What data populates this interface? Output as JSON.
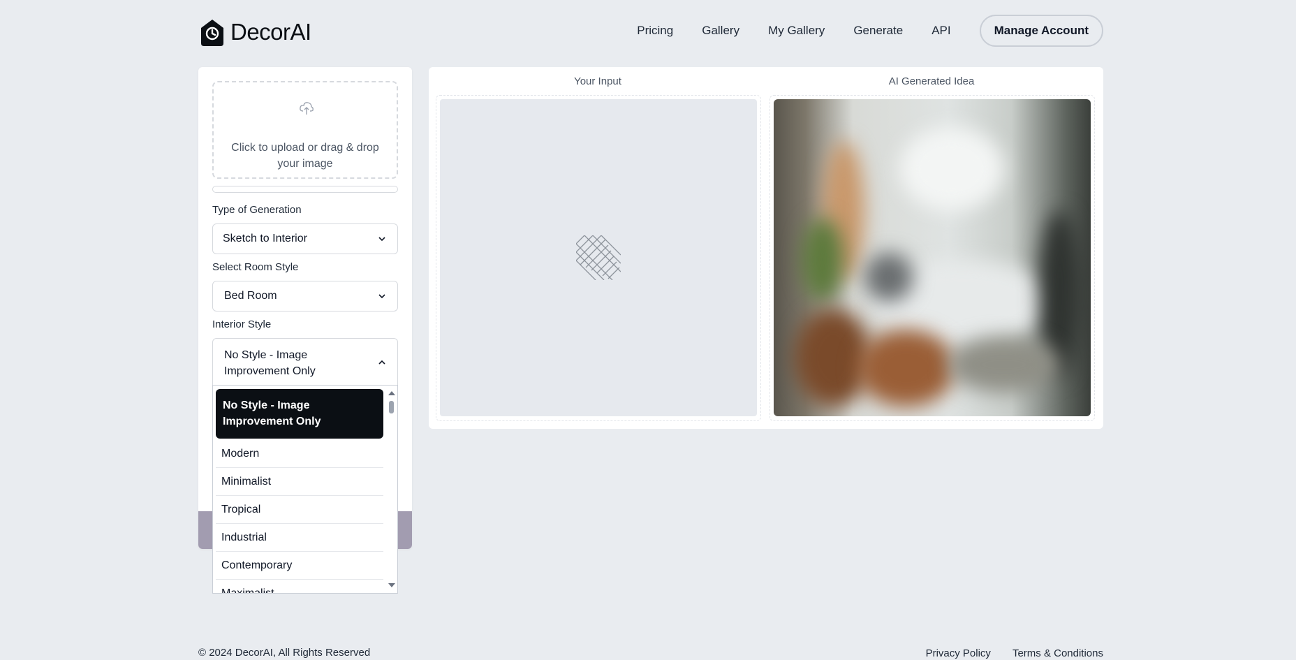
{
  "brand": {
    "name": "DecorAI"
  },
  "nav": {
    "links": [
      "Pricing",
      "Gallery",
      "My Gallery",
      "Generate",
      "API"
    ],
    "manage_account": "Manage Account"
  },
  "upload": {
    "text": "Click to upload or drag & drop your image",
    "icon": "upload-cloud-icon"
  },
  "form": {
    "type_label": "Type of Generation",
    "type_value": "Sketch to Interior",
    "room_label": "Select Room Style",
    "room_value": "Bed Room",
    "interior_label": "Interior Style",
    "interior_value": "No Style - Image Improvement Only"
  },
  "dropdown": {
    "options": [
      "No Style - Image Improvement Only",
      "Modern",
      "Minimalist",
      "Tropical",
      "Industrial",
      "Contemporary",
      "Maximalist"
    ],
    "selected_index": 0
  },
  "preview": {
    "input_label": "Your Input",
    "output_label": "AI Generated Idea"
  },
  "footer": {
    "copyright": "© 2024 DecorAI, All Rights Reserved",
    "privacy": "Privacy Policy",
    "terms": "Terms & Conditions"
  },
  "colors": {
    "background": "#e9ecf0",
    "accent_dark": "#0b0f14",
    "generate_button": "#a29cb0"
  }
}
